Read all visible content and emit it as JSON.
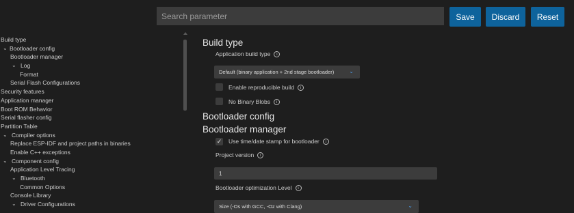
{
  "toolbar": {
    "search_placeholder": "Search parameter",
    "save_label": "Save",
    "discard_label": "Discard",
    "reset_label": "Reset",
    "accent": "#0e639c"
  },
  "sidebar": {
    "items": [
      {
        "label": "Build type",
        "chevron": ""
      },
      {
        "label": "Bootloader config",
        "chevron": "⌄"
      },
      {
        "label": "Bootloader manager",
        "chevron": ""
      },
      {
        "label": "Log",
        "chevron": "⌄"
      },
      {
        "label": "Format",
        "chevron": ""
      },
      {
        "label": "Serial Flash Configurations",
        "chevron": ""
      },
      {
        "label": "Security features",
        "chevron": ""
      },
      {
        "label": "Application manager",
        "chevron": ""
      },
      {
        "label": "Boot ROM Behavior",
        "chevron": ""
      },
      {
        "label": "Serial flasher config",
        "chevron": ""
      },
      {
        "label": "Partition Table",
        "chevron": ""
      },
      {
        "label": "Compiler options",
        "chevron": "⌄"
      },
      {
        "label": "Replace ESP-IDF and project paths in binaries",
        "chevron": ""
      },
      {
        "label": "Enable C++ exceptions",
        "chevron": ""
      },
      {
        "label": "Component config",
        "chevron": "⌄"
      },
      {
        "label": "Application Level Tracing",
        "chevron": ""
      },
      {
        "label": "Bluetooth",
        "chevron": "⌄"
      },
      {
        "label": "Common Options",
        "chevron": ""
      },
      {
        "label": "Console Library",
        "chevron": ""
      },
      {
        "label": "Driver Configurations",
        "chevron": "⌄"
      }
    ]
  },
  "main": {
    "build_type_heading": "Build type",
    "app_build_type_label": "Application build type",
    "app_build_type_value": "Default (binary application + 2nd stage bootloader)",
    "reproducible_label": "Enable reproducible build",
    "reproducible_checked": false,
    "no_binary_blobs_label": "No Binary Blobs",
    "no_binary_blobs_checked": false,
    "bootloader_config_heading": "Bootloader config",
    "bootloader_manager_heading": "Bootloader manager",
    "timestamp_label": "Use time/date stamp for bootloader",
    "timestamp_checked": true,
    "timestamp_check_glyph": "✓",
    "project_version_label": "Project version",
    "project_version_value": "1",
    "optimization_label": "Bootloader optimization Level",
    "optimization_value": "Size (-Os with GCC, -Oz with Clang)",
    "info_glyph": "i",
    "dropdown_glyph": "⌄"
  }
}
